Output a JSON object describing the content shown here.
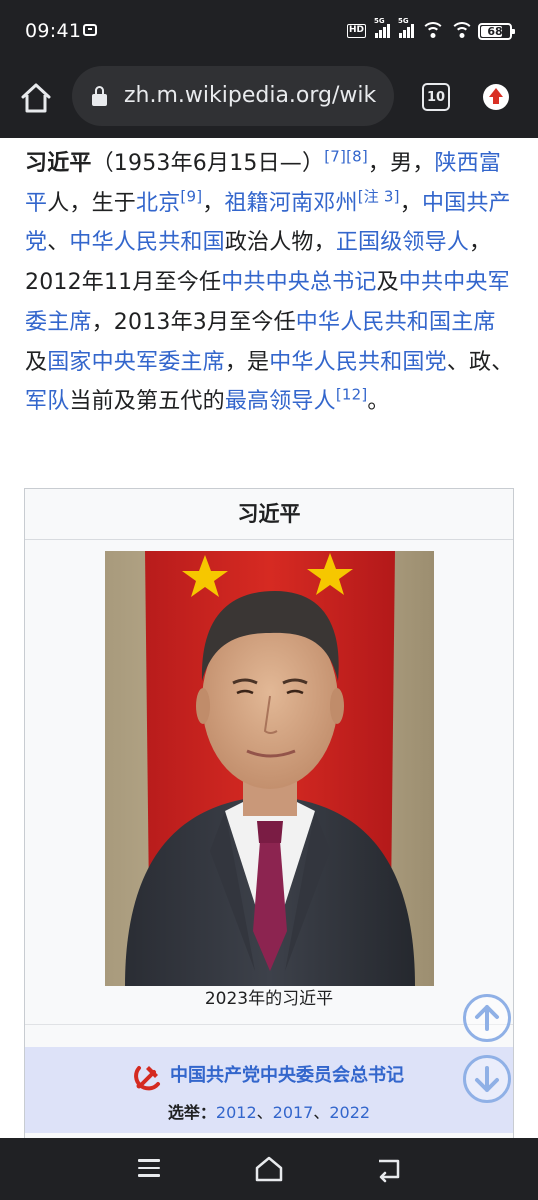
{
  "status_bar": {
    "time": "09:41",
    "hd_label": "HD",
    "signal1_label": "5G",
    "signal2_label": "5G",
    "battery": "68"
  },
  "browser": {
    "url": "zh.m.wikipedia.org/wik",
    "tab_count": "10"
  },
  "article": {
    "segments": [
      {
        "t": "习近平",
        "type": "bold"
      },
      {
        "t": "（1953年6月15日—）",
        "type": "text"
      },
      {
        "t": "[7]",
        "type": "sup"
      },
      {
        "t": "[8]",
        "type": "sup"
      },
      {
        "t": "，男，",
        "type": "text"
      },
      {
        "t": "陕西富平",
        "type": "link"
      },
      {
        "t": "人，生于",
        "type": "text"
      },
      {
        "t": "北京",
        "type": "link"
      },
      {
        "t": "[9]",
        "type": "sup"
      },
      {
        "t": "，",
        "type": "text"
      },
      {
        "t": "祖籍",
        "type": "link"
      },
      {
        "t": "河南",
        "type": "link"
      },
      {
        "t": "邓州",
        "type": "link"
      },
      {
        "t": "[注 3]",
        "type": "sup"
      },
      {
        "t": "，",
        "type": "text"
      },
      {
        "t": "中国共产党",
        "type": "link"
      },
      {
        "t": "、",
        "type": "text"
      },
      {
        "t": "中华人民共和国",
        "type": "link"
      },
      {
        "t": "政治人物，",
        "type": "text"
      },
      {
        "t": "正国级领导人",
        "type": "link"
      },
      {
        "t": "，2012年11月至今任",
        "type": "text"
      },
      {
        "t": "中共中央总书记",
        "type": "link"
      },
      {
        "t": "及",
        "type": "text"
      },
      {
        "t": "中共中央军委主席",
        "type": "link"
      },
      {
        "t": "，2013年3月至今任",
        "type": "text"
      },
      {
        "t": "中华人民共和国主席",
        "type": "link"
      },
      {
        "t": "及",
        "type": "text"
      },
      {
        "t": "国家中央军委主席",
        "type": "link"
      },
      {
        "t": "，是",
        "type": "text"
      },
      {
        "t": "中华人民共和国党",
        "type": "link"
      },
      {
        "t": "、政、",
        "type": "text"
      },
      {
        "t": "军队",
        "type": "link"
      },
      {
        "t": "当前及第五代的",
        "type": "text"
      },
      {
        "t": "最高领导人",
        "type": "link"
      },
      {
        "t": "[12]",
        "type": "sup"
      },
      {
        "t": "。",
        "type": "text"
      }
    ]
  },
  "infobox": {
    "title": "习近平",
    "caption": "2023年的习近平",
    "office_title": "中国共产党中央委员会总书记",
    "election_label": "选举：",
    "election_years": [
      "2012",
      "2017",
      "2022"
    ],
    "election_separator": "、"
  },
  "colors": {
    "link": "#3366cc",
    "chrome_dark": "#202124",
    "office_bg": "#dde2f8"
  },
  "icons": {
    "home": "home-icon",
    "lock": "lock-icon",
    "update": "update-icon",
    "scroll_up": "arrow-up-circle-icon",
    "scroll_down": "arrow-down-circle-icon",
    "party": "hammer-sickle-icon",
    "menu": "menu-icon",
    "back": "back-icon"
  }
}
